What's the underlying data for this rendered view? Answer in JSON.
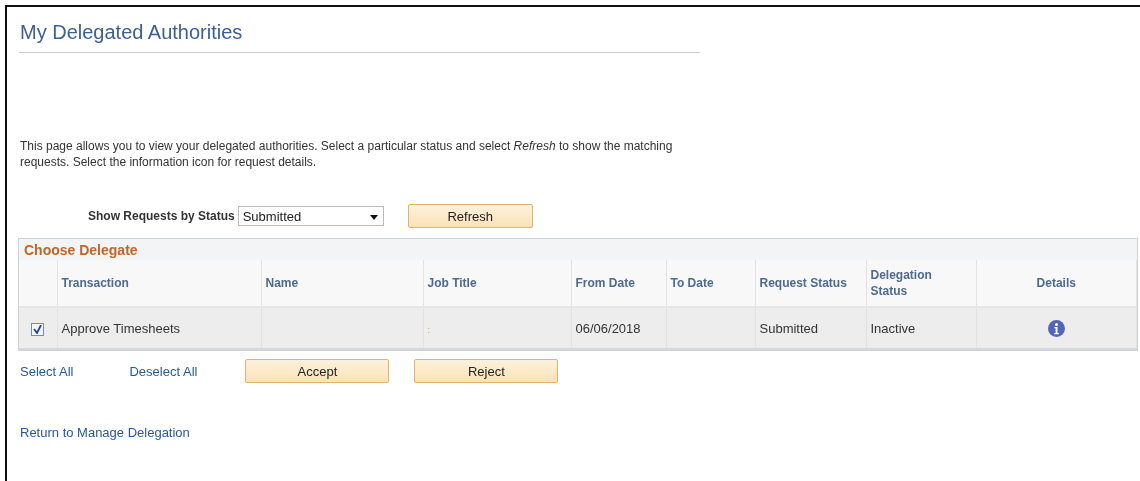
{
  "page": {
    "title": "My Delegated Authorities",
    "intro": "This page allows you to view your delegated authorities. Select a particular status and select *Refresh* to show the matching requests. Select the information icon for request details."
  },
  "filter": {
    "label": "Show Requests by Status",
    "value": "Submitted",
    "button": "Refresh"
  },
  "grid": {
    "title": "Choose Delegate",
    "columns": [
      "Transaction",
      "Name",
      "Job Title",
      "From Date",
      "To Date",
      "Request Status",
      "Delegation Status",
      "Details"
    ],
    "rows": [
      {
        "checked": true,
        "transaction": "Approve Timesheets",
        "name": "",
        "job_title": ":",
        "from_date": "06/06/2018",
        "to_date": "",
        "request_status": "Submitted",
        "delegation_status": "Inactive"
      }
    ]
  },
  "actions": {
    "links": [
      "Select All",
      "Deselect All"
    ],
    "buttons": [
      "Accept",
      "Reject"
    ]
  },
  "return_link": "Return to Manage Delegation"
}
